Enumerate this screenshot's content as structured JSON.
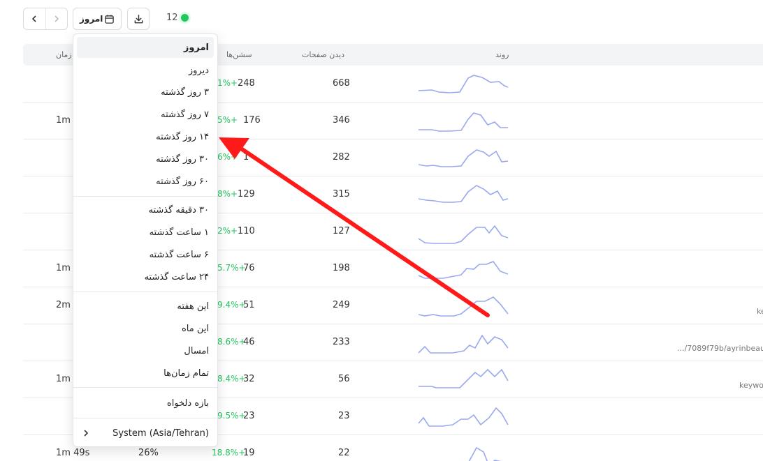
{
  "toolbar": {
    "date_label": "امروز",
    "live_count": "12"
  },
  "table": {
    "headers": {
      "trend": "روند",
      "pageviews": "دیدن صفحات",
      "sessions": "سشن‌ها",
      "time": "زمان"
    },
    "rows": [
      {
        "pageviews": "668",
        "sessions": "248",
        "growth": "1%+",
        "time": "",
        "path": ""
      },
      {
        "pageviews": "346",
        "sessions": "176",
        "growth": "5%+",
        "time": "1m",
        "path": ""
      },
      {
        "pageviews": "282",
        "sessions": "1",
        "growth": "6%+",
        "time": "",
        "path": ""
      },
      {
        "pageviews": "315",
        "sessions": "129",
        "growth": "8%+",
        "time": "",
        "path": ""
      },
      {
        "pageviews": "127",
        "sessions": "110",
        "growth": "2%+",
        "time": "",
        "path": ""
      },
      {
        "pageviews": "198",
        "sessions": "76",
        "growth": "5.7%+",
        "time": "1m",
        "path": ""
      },
      {
        "pageviews": "249",
        "sessions": "51",
        "growth": "9.4%+",
        "time": "2m",
        "path": "ke"
      },
      {
        "pageviews": "233",
        "sessions": "46",
        "growth": "8.6%+",
        "time": "",
        "path": ".../7089f79b/ayrinbeaut"
      },
      {
        "pageviews": "56",
        "sessions": "32",
        "growth": "8.4%+",
        "time": "1m",
        "path": "keywo"
      },
      {
        "pageviews": "23",
        "sessions": "23",
        "growth": "9.5%+",
        "time": "",
        "path": ""
      },
      {
        "pageviews": "22",
        "sessions": "19",
        "growth": "18.8%+",
        "time": "1m 49s",
        "path": "",
        "extra": "26%"
      }
    ]
  },
  "menu": {
    "items": [
      "امروز",
      "دیروز",
      "۳ روز گذشته",
      "۷ روز گذشته",
      "۱۴ روز گذشته",
      "۳۰ روز گذشته",
      "۶۰ روز گذشته",
      "۳۰ دقیقه گذشته",
      "۱ ساعت گذشته",
      "۶ ساعت گذشته",
      "۲۴ ساعت گذشته",
      "این هفته",
      "این ماه",
      "امسال",
      "تمام زمان‌ها",
      "بازه دلخواه"
    ],
    "timezone": "System (Asia/Tehran)"
  },
  "colors": {
    "accent_green": "#22c55e",
    "sparkline": "#9aa8ee",
    "arrow": "#ff1a1a"
  }
}
